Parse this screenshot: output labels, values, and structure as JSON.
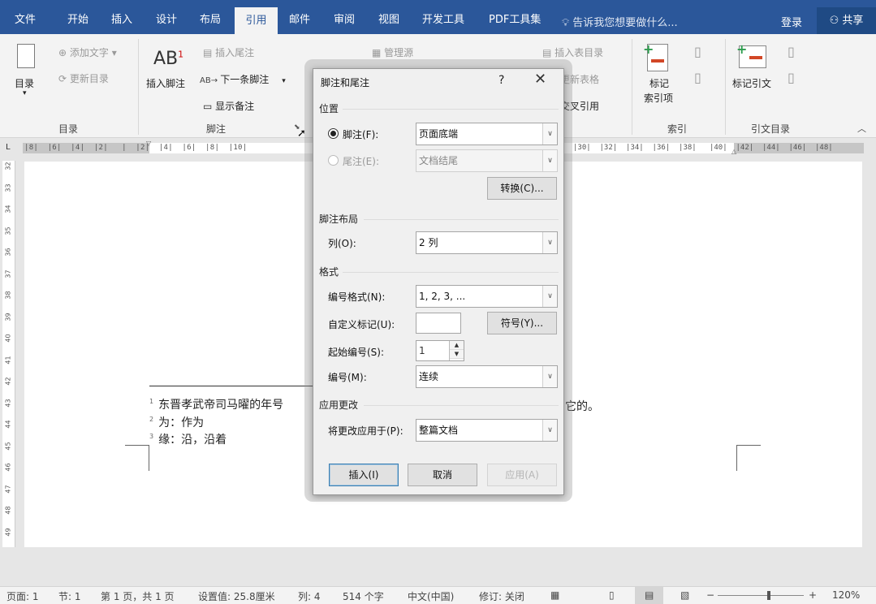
{
  "tabs": [
    "文件",
    "开始",
    "插入",
    "设计",
    "布局",
    "引用",
    "邮件",
    "审阅",
    "视图",
    "开发工具",
    "PDF工具集"
  ],
  "active_tab": "引用",
  "tell_me": "告诉我您想要做什么...",
  "login": "登录",
  "share": "共享",
  "ribbon": {
    "toc": {
      "button": "目录",
      "add_text": "添加文字",
      "update_toc": "更新目录",
      "group": "目录"
    },
    "footnotes": {
      "insert_footnote": "插入脚注",
      "insert_endnote": "插入尾注",
      "next_footnote": "下一条脚注",
      "show_notes": "显示备注",
      "group": "脚注",
      "ab_text": "AB",
      "ab_sup": "1"
    },
    "citations": {
      "manage_sources": "管理源"
    },
    "captions": {
      "insert_table_of_figures": "插入表目录",
      "update_table": "更新表格",
      "cross_reference": "交叉引用"
    },
    "index": {
      "mark_entry_line1": "标记",
      "mark_entry_line2": "索引项",
      "group": "索引"
    },
    "toa": {
      "mark_citation": "标记引文",
      "group": "引文目录"
    }
  },
  "ruler": {
    "numbers": "|8|  |6|  |4|  |2|   |  |2|  |4|  |6|  |8|  |10|",
    "numbers_right": "|30|  |32|  |34|  |36|  |38|   |40|  |42|  |44|  |46|  |48|",
    "vertical": [
      "32",
      "33",
      "34",
      "35",
      "36",
      "37",
      "38",
      "39",
      "40",
      "41",
      "42",
      "43",
      "44",
      "45",
      "46",
      "47",
      "48",
      "49"
    ],
    "corner": "L"
  },
  "document": {
    "footnotes": [
      {
        "mark": "1",
        "text": "东晋孝武帝司马曜的年号"
      },
      {
        "mark": "2",
        "text": "为：作为"
      },
      {
        "mark": "3",
        "text": "缘：沿，沿着"
      }
    ],
    "tail_text": "它的。"
  },
  "dialog": {
    "title": "脚注和尾注",
    "help": "?",
    "close": "✕",
    "position_section": "位置",
    "footnote_label": "脚注(F):",
    "footnote_value": "页面底端",
    "endnote_label": "尾注(E):",
    "endnote_value": "文档结尾",
    "convert_button": "转换(C)...",
    "layout_section": "脚注布局",
    "columns_label": "列(O):",
    "columns_value": "2 列",
    "format_section": "格式",
    "number_format_label": "编号格式(N):",
    "number_format_value": "1, 2, 3, ...",
    "custom_mark_label": "自定义标记(U):",
    "custom_mark_value": "",
    "symbol_button": "符号(Y)...",
    "start_at_label": "起始编号(S):",
    "start_at_value": "1",
    "numbering_label": "编号(M):",
    "numbering_value": "连续",
    "apply_section": "应用更改",
    "apply_to_label": "将更改应用于(P):",
    "apply_to_value": "整篇文档",
    "insert_button": "插入(I)",
    "cancel_button": "取消",
    "apply_button": "应用(A)"
  },
  "status": {
    "page": "页面: 1",
    "section": "节: 1",
    "page_of": "第 1 页，共 1 页",
    "at": "设置值: 25.8厘米",
    "column": "列: 4",
    "words": "514 个字",
    "language": "中文(中国)",
    "track": "修订: 关闭",
    "zoom": "120%",
    "zoom_level": 0.6
  },
  "colors": {
    "accent": "#2b579a",
    "share_bg": "#1f4a84"
  }
}
